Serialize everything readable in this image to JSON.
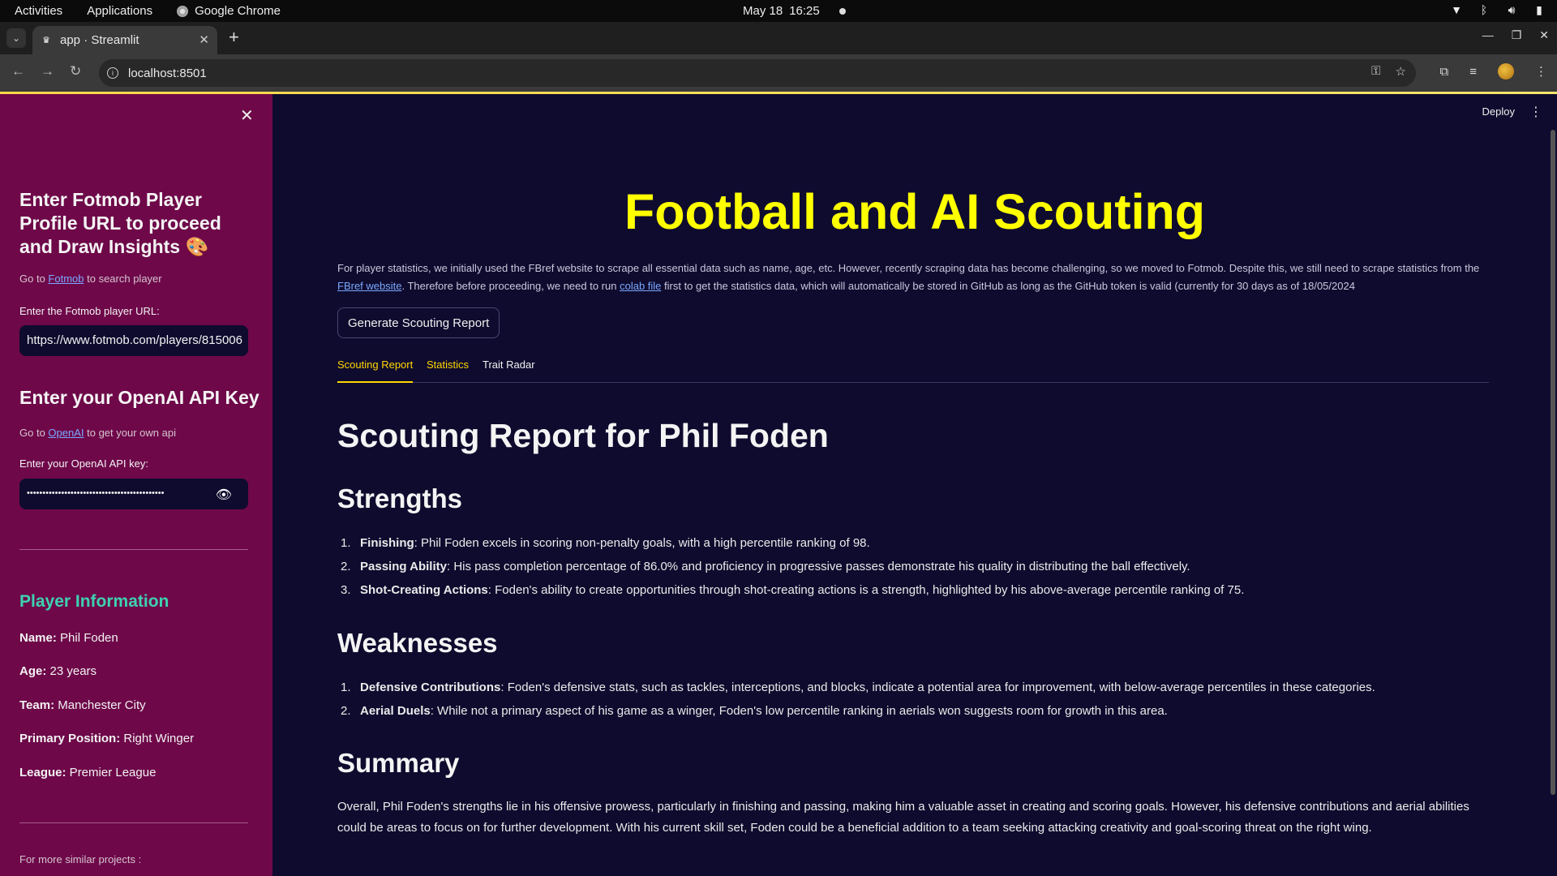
{
  "os_topbar": {
    "activities": "Activities",
    "applications": "Applications",
    "app_name": "Google Chrome",
    "date": "May 18",
    "time": "16:25"
  },
  "browser": {
    "tab_title": "app · Streamlit",
    "url": "localhost:8501"
  },
  "sidebar": {
    "heading1": "Enter Fotmob Player Profile URL to proceed and Draw Insights 🎨",
    "fotmob_prefix": "Go to ",
    "fotmob_link": "Fotmob",
    "fotmob_suffix": " to search player",
    "url_label": "Enter the Fotmob player URL:",
    "url_value": "https://www.fotmob.com/players/815006",
    "heading2": "Enter your OpenAI API Key",
    "openai_prefix": "Go to ",
    "openai_link": "OpenAI",
    "openai_suffix": " to get your own api",
    "api_label": "Enter your OpenAI API key:",
    "api_value": "••••••••••••••••••••••••••••••••••••••••••••",
    "player_info_title": "Player Information",
    "info": [
      {
        "label": "Name:",
        "value": " Phil Foden"
      },
      {
        "label": "Age:",
        "value": " 23 years"
      },
      {
        "label": "Team:",
        "value": " Manchester City"
      },
      {
        "label": "Primary Position:",
        "value": " Right Winger"
      },
      {
        "label": "League:",
        "value": " Premier League"
      }
    ],
    "more_projects": "For more similar projects :"
  },
  "main": {
    "deploy": "Deploy",
    "title": "Football and AI Scouting",
    "intro_part1": "For player statistics, we initially used the FBref website to scrape all essential data such as name, age, etc. However, recently scraping data has become challenging, so we moved to Fotmob. Despite this, we still need to scrape statistics from the ",
    "intro_link1": "FBref website",
    "intro_part2": ". Therefore before proceeding, we need to run ",
    "intro_link2": "colab file",
    "intro_part3": " first to get the statistics data, which will automatically be stored in GitHub as long as the GitHub token is valid (currently for 30 days as of 18/05/2024",
    "generate_button": "Generate Scouting Report",
    "tabs": [
      "Scouting Report",
      "Statistics",
      "Trait Radar"
    ],
    "report_title": "Scouting Report for Phil Foden",
    "strengths_title": "Strengths",
    "strengths": [
      {
        "num": "1.",
        "label": "Finishing",
        "text": ": Phil Foden excels in scoring non-penalty goals, with a high percentile ranking of 98."
      },
      {
        "num": "2.",
        "label": "Passing Ability",
        "text": ": His pass completion percentage of 86.0% and proficiency in progressive passes demonstrate his quality in distributing the ball effectively."
      },
      {
        "num": "3.",
        "label": "Shot-Creating Actions",
        "text": ": Foden's ability to create opportunities through shot-creating actions is a strength, highlighted by his above-average percentile ranking of 75."
      }
    ],
    "weaknesses_title": "Weaknesses",
    "weaknesses": [
      {
        "num": "1.",
        "label": "Defensive Contributions",
        "text": ": Foden's defensive stats, such as tackles, interceptions, and blocks, indicate a potential area for improvement, with below-average percentiles in these categories."
      },
      {
        "num": "2.",
        "label": "Aerial Duels",
        "text": ": While not a primary aspect of his game as a winger, Foden's low percentile ranking in aerials won suggests room for growth in this area."
      }
    ],
    "summary_title": "Summary",
    "summary": "Overall, Phil Foden's strengths lie in his offensive prowess, particularly in finishing and passing, making him a valuable asset in creating and scoring goals. However, his defensive contributions and aerial abilities could be areas to focus on for further development. With his current skill set, Foden could be a beneficial addition to a team seeking attacking creativity and goal-scoring threat on the right wing."
  }
}
